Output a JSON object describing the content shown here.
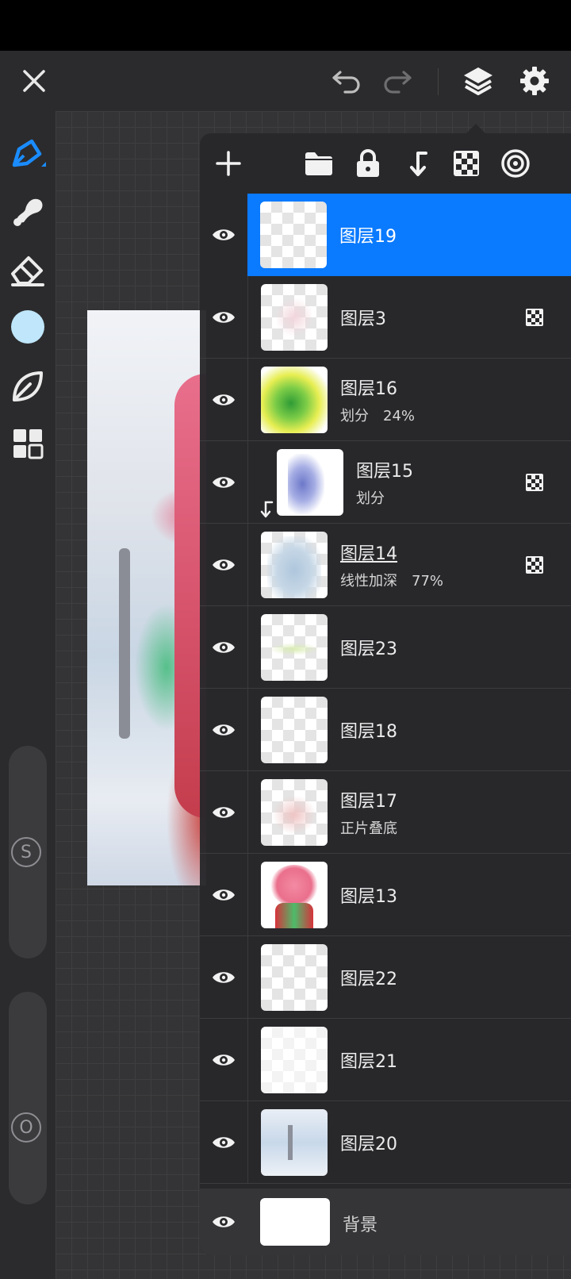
{
  "topbar": {
    "close_icon": "close-icon",
    "undo_icon": "undo-icon",
    "redo_icon": "redo-icon",
    "layers_icon": "layers-icon",
    "settings_icon": "gear-icon"
  },
  "sidebar": {
    "tools": [
      "brush-icon",
      "smudge-icon",
      "eraser-icon",
      "color-swatch",
      "leaf-icon",
      "grid-icon"
    ],
    "color": "#bfe6fa",
    "slider_size_label": "S",
    "slider_opacity_label": "O"
  },
  "layers_panel": {
    "toolbar_icons": [
      "add-icon",
      "folder-icon",
      "lock-icon",
      "clip-icon",
      "checker-icon",
      "target-icon"
    ],
    "accent_color": "#0a7aff",
    "layers": [
      {
        "name": "图层19",
        "sub": "",
        "selected": true,
        "checker": false
      },
      {
        "name": "图层3",
        "sub": "",
        "selected": false,
        "checker": true
      },
      {
        "name": "图层16",
        "sub": "划分　24%",
        "selected": false,
        "checker": false
      },
      {
        "name": "图层15",
        "sub": "划分",
        "selected": false,
        "checker": true,
        "clipped": true
      },
      {
        "name": "图层14",
        "sub": "线性加深　77%",
        "selected": false,
        "checker": true
      },
      {
        "name": "图层23",
        "sub": "",
        "selected": false,
        "checker": false
      },
      {
        "name": "图层18",
        "sub": "",
        "selected": false,
        "checker": false
      },
      {
        "name": "图层17",
        "sub": "正片叠底",
        "selected": false,
        "checker": false
      },
      {
        "name": "图层13",
        "sub": "",
        "selected": false,
        "checker": false
      },
      {
        "name": "图层22",
        "sub": "",
        "selected": false,
        "checker": false
      },
      {
        "name": "图层21",
        "sub": "",
        "selected": false,
        "checker": false
      },
      {
        "name": "图层20",
        "sub": "",
        "selected": false,
        "checker": false
      }
    ],
    "background": {
      "name": "背景"
    }
  }
}
